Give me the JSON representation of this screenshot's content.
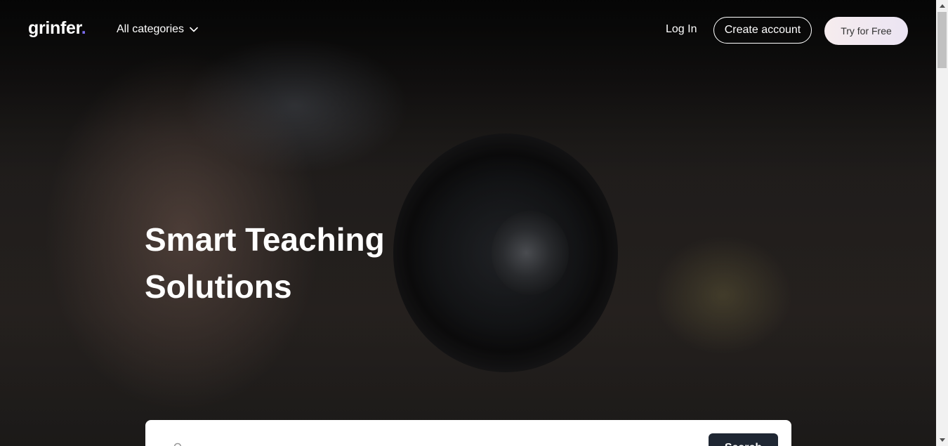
{
  "header": {
    "logo_text": "grinfer",
    "logo_dot": ".",
    "categories_label": "All categories",
    "login_label": "Log In",
    "create_account_label": "Create account",
    "try_free_label": "Try for Free"
  },
  "hero": {
    "title_line1": "Smart Teaching",
    "title_line2": "Solutions"
  },
  "search": {
    "button_label": "Search"
  },
  "colors": {
    "logo_accent": "#7c6cf0",
    "search_button": "#1f2733",
    "try_button_start": "#f6ecee",
    "try_button_end": "#ebe4f3"
  },
  "icons": [
    "chevron-down-icon",
    "search-icon",
    "scroll-up-arrow-icon",
    "scroll-down-arrow-icon"
  ]
}
